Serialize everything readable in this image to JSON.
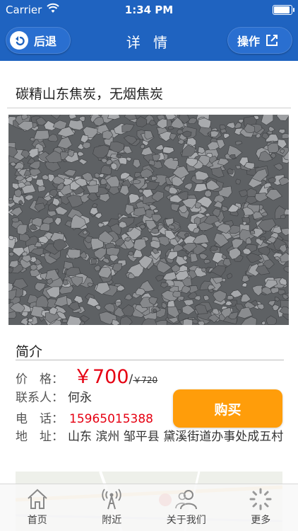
{
  "status_bar": {
    "carrier": "Carrier",
    "time": "1:34 PM"
  },
  "nav": {
    "back_label": "后退",
    "title": "详 情",
    "ops_label": "操作"
  },
  "product": {
    "title": "碳精山东焦炭，无烟焦炭",
    "image_icon": "coke-gravel-photo"
  },
  "intro": {
    "heading": "简介",
    "price_label": "价　格：",
    "price": "￥700",
    "price_sep": "/",
    "original_price": "￥720",
    "contact_label": "联系人：",
    "contact": "何永",
    "phone_label": "电　话：",
    "phone": "15965015388",
    "address_label": "地　址：",
    "address": "山东 滨州 邹平县 黛溪街道办事处成五村"
  },
  "buy_button": "购买",
  "tabs": [
    {
      "label": "首页",
      "icon": "home-icon"
    },
    {
      "label": "附近",
      "icon": "signal-tower-icon"
    },
    {
      "label": "关于我们",
      "icon": "people-icon"
    },
    {
      "label": "更多",
      "icon": "loading-dots-icon"
    }
  ],
  "colors": {
    "nav": "#1f63c0",
    "price": "#e60012",
    "buy": "#ff9d0a"
  }
}
